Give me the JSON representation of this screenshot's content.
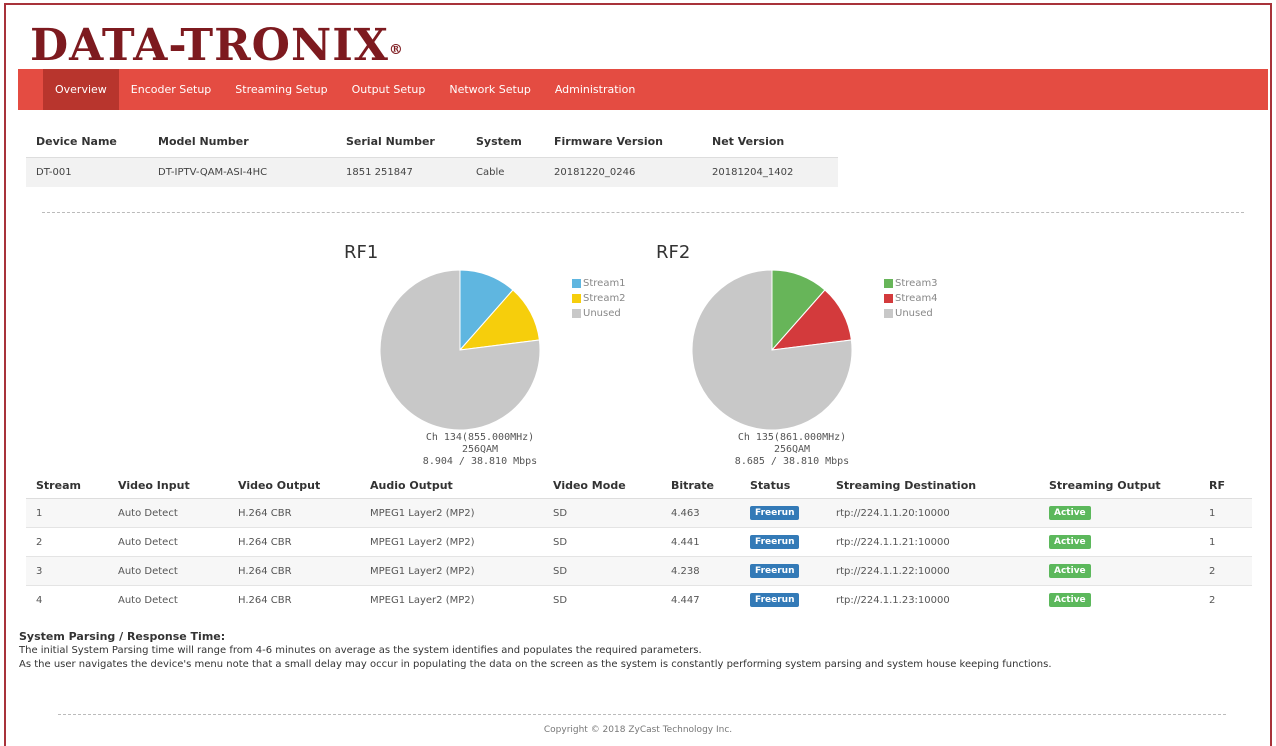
{
  "brand": {
    "logo_text": "DATA-TRONIX",
    "registered_mark": "®"
  },
  "nav": {
    "items": [
      {
        "label": "Overview",
        "active": true
      },
      {
        "label": "Encoder Setup",
        "active": false
      },
      {
        "label": "Streaming Setup",
        "active": false
      },
      {
        "label": "Output Setup",
        "active": false
      },
      {
        "label": "Network Setup",
        "active": false
      },
      {
        "label": "Administration",
        "active": false
      }
    ]
  },
  "device": {
    "headers": [
      "Device Name",
      "Model Number",
      "Serial Number",
      "System",
      "Firmware Version",
      "Net Version"
    ],
    "values": [
      "DT-001",
      "DT-IPTV-QAM-ASI-4HC",
      "1851 251847",
      "Cable",
      "20181220_0246",
      "20181204_1402"
    ]
  },
  "colors": {
    "accent": "#e44c42",
    "logo": "#7d1a1f",
    "stream1": "#5fb6e0",
    "stream2": "#f6ce0c",
    "stream3": "#67b559",
    "stream4": "#d33a3c",
    "unused": "#c8c8c8"
  },
  "rf": [
    {
      "title": "RF1",
      "legend": [
        "Stream1",
        "Stream2",
        "Unused"
      ],
      "slices": [
        0.115,
        0.115,
        0.77
      ],
      "channel": "Ch 134(855.000MHz)",
      "modulation": "256QAM",
      "rate": "8.904 / 38.810 Mbps"
    },
    {
      "title": "RF2",
      "legend": [
        "Stream3",
        "Stream4",
        "Unused"
      ],
      "slices": [
        0.115,
        0.115,
        0.77
      ],
      "channel": "Ch 135(861.000MHz)",
      "modulation": "256QAM",
      "rate": "8.685 / 38.810 Mbps"
    }
  ],
  "streams": {
    "headers": [
      "Stream",
      "Video Input",
      "Video Output",
      "Audio Output",
      "Video Mode",
      "Bitrate",
      "Status",
      "Streaming Destination",
      "Streaming Output",
      "RF"
    ],
    "rows": [
      [
        "1",
        "Auto Detect",
        "H.264 CBR",
        "MPEG1 Layer2 (MP2)",
        "SD",
        "4.463",
        "Freerun",
        "rtp://224.1.1.20:10000",
        "Active",
        "1"
      ],
      [
        "2",
        "Auto Detect",
        "H.264 CBR",
        "MPEG1 Layer2 (MP2)",
        "SD",
        "4.441",
        "Freerun",
        "rtp://224.1.1.21:10000",
        "Active",
        "1"
      ],
      [
        "3",
        "Auto Detect",
        "H.264 CBR",
        "MPEG1 Layer2 (MP2)",
        "SD",
        "4.238",
        "Freerun",
        "rtp://224.1.1.22:10000",
        "Active",
        "2"
      ],
      [
        "4",
        "Auto Detect",
        "H.264 CBR",
        "MPEG1 Layer2 (MP2)",
        "SD",
        "4.447",
        "Freerun",
        "rtp://224.1.1.23:10000",
        "Active",
        "2"
      ]
    ]
  },
  "notes": {
    "title": "System Parsing / Response Time:",
    "line1": "The initial System Parsing time will range from 4-6 minutes on average as the system identifies and populates the required parameters.",
    "line2": "As the user navigates the device's menu note that a small delay may occur in populating the data on the screen as the system is constantly performing system parsing and system house keeping functions."
  },
  "footer": {
    "copyright": "Copyright © 2018 ZyCast Technology Inc."
  }
}
